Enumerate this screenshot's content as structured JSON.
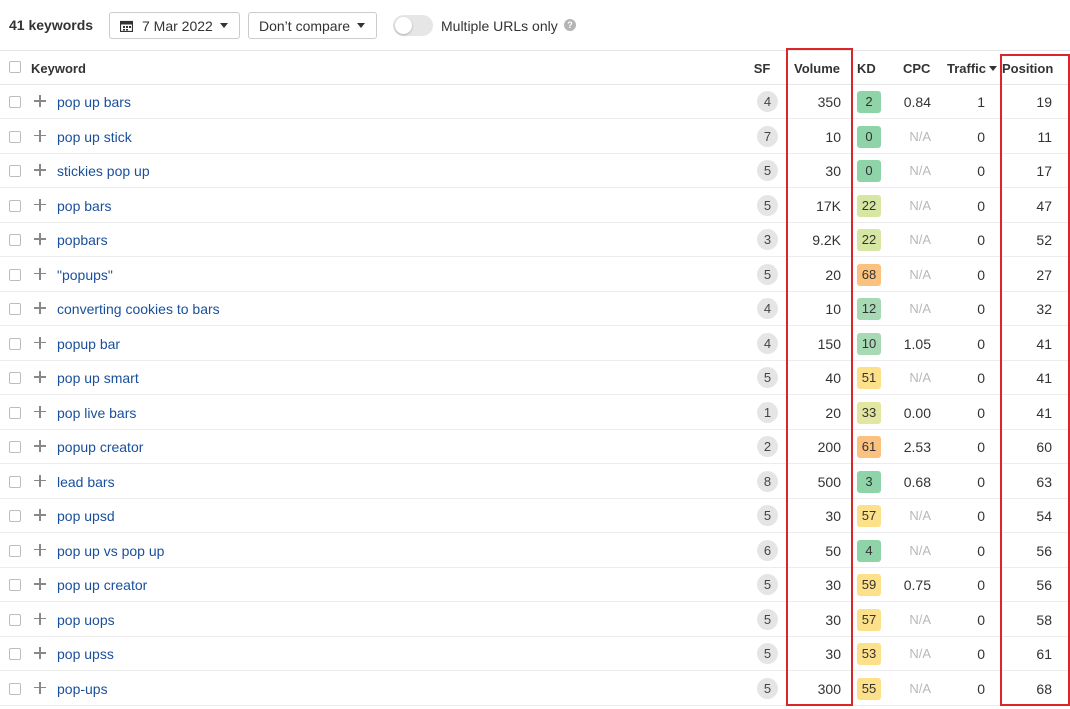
{
  "toolbar": {
    "keyword_count": "41 keywords",
    "date_label": "7 Mar 2022",
    "compare_label": "Don’t compare",
    "toggle_label": "Multiple URLs only",
    "toggle_on": false,
    "help_glyph": "?"
  },
  "columns": {
    "keyword": "Keyword",
    "sf": "SF",
    "volume": "Volume",
    "kd": "KD",
    "cpc": "CPC",
    "traffic": "Traffic",
    "position": "Position"
  },
  "kd_colors": {
    "green": "#8fd3a8",
    "light_green": "#a8d9b5",
    "yellow_green": "#d6e6a3",
    "yellow": "#fde08a",
    "orange": "#fbc27f"
  },
  "rows": [
    {
      "keyword": "pop up bars",
      "sf": "4",
      "volume": "350",
      "kd": "2",
      "kd_color": "#8fd3a8",
      "cpc": "0.84",
      "traffic": "1",
      "position": "19"
    },
    {
      "keyword": "pop up stick",
      "sf": "7",
      "volume": "10",
      "kd": "0",
      "kd_color": "#8fd3a8",
      "cpc": "N/A",
      "traffic": "0",
      "position": "11"
    },
    {
      "keyword": "stickies pop up",
      "sf": "5",
      "volume": "30",
      "kd": "0",
      "kd_color": "#8fd3a8",
      "cpc": "N/A",
      "traffic": "0",
      "position": "17"
    },
    {
      "keyword": "pop bars",
      "sf": "5",
      "volume": "17K",
      "kd": "22",
      "kd_color": "#d6e6a3",
      "cpc": "N/A",
      "traffic": "0",
      "position": "47"
    },
    {
      "keyword": "popbars",
      "sf": "3",
      "volume": "9.2K",
      "kd": "22",
      "kd_color": "#d6e6a3",
      "cpc": "N/A",
      "traffic": "0",
      "position": "52"
    },
    {
      "keyword": "\"popups\"",
      "sf": "5",
      "volume": "20",
      "kd": "68",
      "kd_color": "#fbc27f",
      "cpc": "N/A",
      "traffic": "0",
      "position": "27"
    },
    {
      "keyword": "converting cookies to bars",
      "sf": "4",
      "volume": "10",
      "kd": "12",
      "kd_color": "#a8d9b5",
      "cpc": "N/A",
      "traffic": "0",
      "position": "32"
    },
    {
      "keyword": "popup bar",
      "sf": "4",
      "volume": "150",
      "kd": "10",
      "kd_color": "#a8d9b5",
      "cpc": "1.05",
      "traffic": "0",
      "position": "41"
    },
    {
      "keyword": "pop up smart",
      "sf": "5",
      "volume": "40",
      "kd": "51",
      "kd_color": "#fde08a",
      "cpc": "N/A",
      "traffic": "0",
      "position": "41"
    },
    {
      "keyword": "pop live bars",
      "sf": "1",
      "volume": "20",
      "kd": "33",
      "kd_color": "#e3e6a0",
      "cpc": "0.00",
      "traffic": "0",
      "position": "41"
    },
    {
      "keyword": "popup creator",
      "sf": "2",
      "volume": "200",
      "kd": "61",
      "kd_color": "#fbc27f",
      "cpc": "2.53",
      "traffic": "0",
      "position": "60"
    },
    {
      "keyword": "lead bars",
      "sf": "8",
      "volume": "500",
      "kd": "3",
      "kd_color": "#8fd3a8",
      "cpc": "0.68",
      "traffic": "0",
      "position": "63"
    },
    {
      "keyword": "pop upsd",
      "sf": "5",
      "volume": "30",
      "kd": "57",
      "kd_color": "#fde08a",
      "cpc": "N/A",
      "traffic": "0",
      "position": "54"
    },
    {
      "keyword": "pop up vs pop up",
      "sf": "6",
      "volume": "50",
      "kd": "4",
      "kd_color": "#8fd3a8",
      "cpc": "N/A",
      "traffic": "0",
      "position": "56"
    },
    {
      "keyword": "pop up creator",
      "sf": "5",
      "volume": "30",
      "kd": "59",
      "kd_color": "#fde08a",
      "cpc": "0.75",
      "traffic": "0",
      "position": "56"
    },
    {
      "keyword": "pop uops",
      "sf": "5",
      "volume": "30",
      "kd": "57",
      "kd_color": "#fde08a",
      "cpc": "N/A",
      "traffic": "0",
      "position": "58"
    },
    {
      "keyword": "pop upss",
      "sf": "5",
      "volume": "30",
      "kd": "53",
      "kd_color": "#fde08a",
      "cpc": "N/A",
      "traffic": "0",
      "position": "61"
    },
    {
      "keyword": "pop-ups",
      "sf": "5",
      "volume": "300",
      "kd": "55",
      "kd_color": "#fde08a",
      "cpc": "N/A",
      "traffic": "0",
      "position": "68"
    }
  ],
  "highlight_color": "#d9262b"
}
